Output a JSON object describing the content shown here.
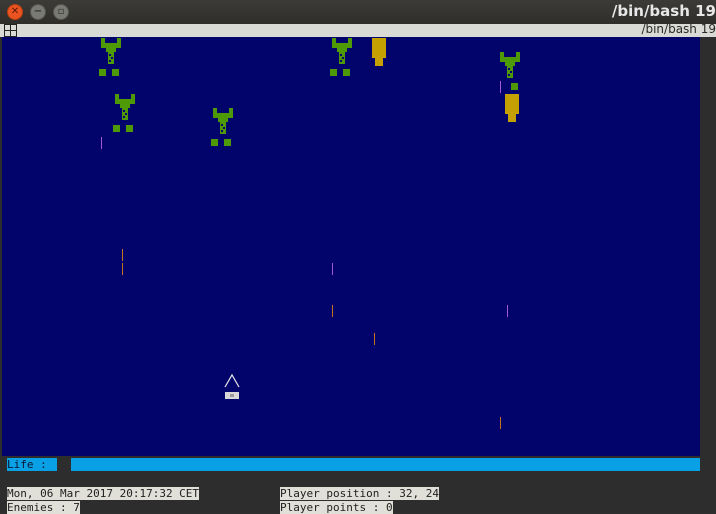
{
  "window": {
    "title": "/bin/bash 19",
    "tab_title": "/bin/bash 19"
  },
  "hud": {
    "life_label": "Life : ",
    "life_level": 1.0,
    "datetime": "Mon, 06 Mar 2017 20:17:32 CET",
    "enemies": "Enemies : 7",
    "player_position": "Player position : 32, 24",
    "player_points": "Player points : 0"
  },
  "colors": {
    "sky": "#02046b",
    "enemy": "#4e9a06",
    "bomb": "#c4a000",
    "life_bar": "#0aa0e6",
    "laser_orange": "#c4721d",
    "laser_magenta": "#a05ad0",
    "ship": "#e8e8e8"
  },
  "entities": [
    {
      "kind": "enemy",
      "icon": "alien-icon"
    },
    {
      "kind": "enemy",
      "icon": "alien-icon"
    },
    {
      "kind": "enemy",
      "icon": "alien-icon"
    },
    {
      "kind": "enemy",
      "icon": "alien-icon"
    },
    {
      "kind": "enemy",
      "icon": "alien-icon"
    },
    {
      "kind": "bomb",
      "icon": "bomb-icon"
    },
    {
      "kind": "bomb",
      "icon": "bomb-icon"
    },
    {
      "kind": "laser",
      "icon": "laser-icon"
    },
    {
      "kind": "laser",
      "icon": "laser-icon"
    },
    {
      "kind": "laser",
      "icon": "laser-icon"
    },
    {
      "kind": "laser",
      "icon": "laser-icon"
    },
    {
      "kind": "laser",
      "icon": "laser-icon"
    },
    {
      "kind": "laser",
      "icon": "laser-icon"
    },
    {
      "kind": "laser",
      "icon": "laser-icon"
    },
    {
      "kind": "laser",
      "icon": "laser-icon"
    },
    {
      "kind": "laser",
      "icon": "laser-icon"
    },
    {
      "kind": "player",
      "icon": "spaceship-icon"
    }
  ]
}
